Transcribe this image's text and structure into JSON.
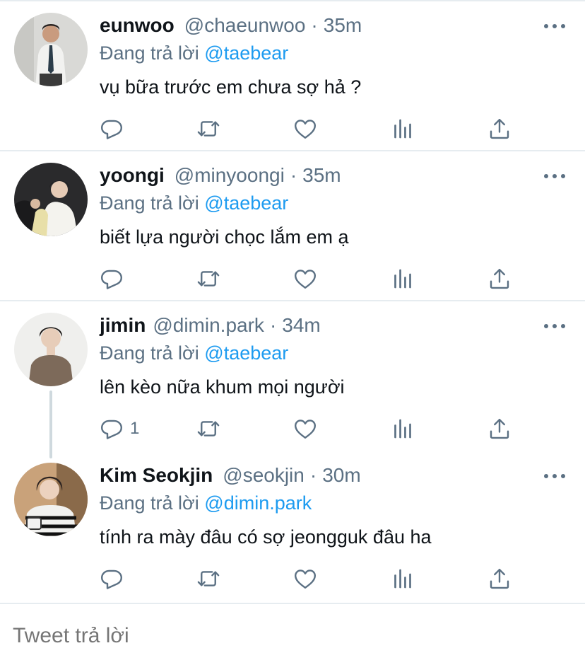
{
  "reply_label": "Đang trả lời",
  "tweets": [
    {
      "name": "eunwoo",
      "handle": "@chaeunwoo",
      "time": "35m",
      "mention": "@taebear",
      "text": "vụ bữa trước em chưa sợ hả ?",
      "reply_count": ""
    },
    {
      "name": "yoongi",
      "handle": "@minyoongi",
      "time": "35m",
      "mention": "@taebear",
      "text": "biết lựa người chọc lắm em ạ",
      "reply_count": ""
    },
    {
      "name": "jimin",
      "handle": "@dimin.park",
      "time": "34m",
      "mention": "@taebear",
      "text": "lên kèo nữa khum mọi người",
      "reply_count": "1"
    },
    {
      "name": "Kim Seokjin",
      "handle": "@seokjin",
      "time": "30m",
      "mention": "@dimin.park",
      "text": "tính ra mày đâu có sợ jeongguk đâu ha",
      "reply_count": ""
    }
  ],
  "separator": "·",
  "composer": {
    "placeholder": "Tweet trả lời"
  },
  "colors": {
    "link": "#1d9bf0",
    "secondary": "#5b7083",
    "divider": "#e6ecf0"
  },
  "icons": [
    "reply-icon",
    "retweet-icon",
    "like-icon",
    "analytics-icon",
    "share-icon",
    "more-icon"
  ]
}
